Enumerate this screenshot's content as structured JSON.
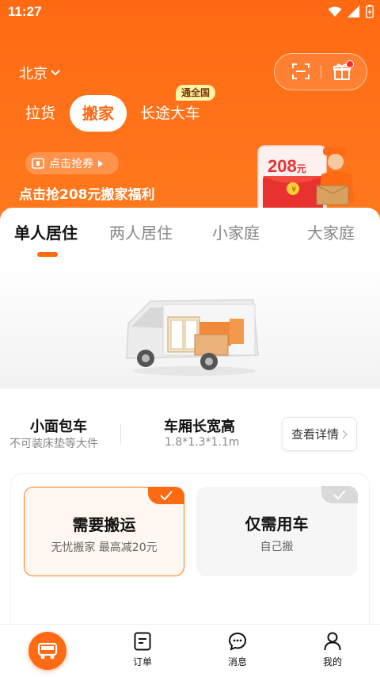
{
  "status_bar": {
    "time": "11:27"
  },
  "header": {
    "city": "北京",
    "service_tabs": [
      {
        "label": "拉货"
      },
      {
        "label": "搬家",
        "active": true
      },
      {
        "label": "长途大车"
      }
    ],
    "badge": "通全国",
    "coupon_pill": "点击抢券",
    "promo_title": "点击抢208元搬家福利",
    "redpacket_amount": "208",
    "redpacket_unit": "元"
  },
  "size_tabs": [
    "单人居住",
    "两人居住",
    "小家庭",
    "大家庭"
  ],
  "vehicle": {
    "name": "小面包车",
    "note": "不可装床垫等大件",
    "dim_label": "车厢长宽高",
    "dim_value": "1.8*1.3*1.1m",
    "details_label": "查看详情"
  },
  "options": [
    {
      "title": "需要搬运",
      "subtitle": "无忧搬家 最高减20元",
      "selected": true
    },
    {
      "title": "仅需用车",
      "subtitle": "自己搬",
      "selected": false
    }
  ],
  "bottom_nav": [
    {
      "label": "订单"
    },
    {
      "label": "消息"
    },
    {
      "label": "我的"
    }
  ],
  "colors": {
    "accent": "#ff6a13"
  }
}
